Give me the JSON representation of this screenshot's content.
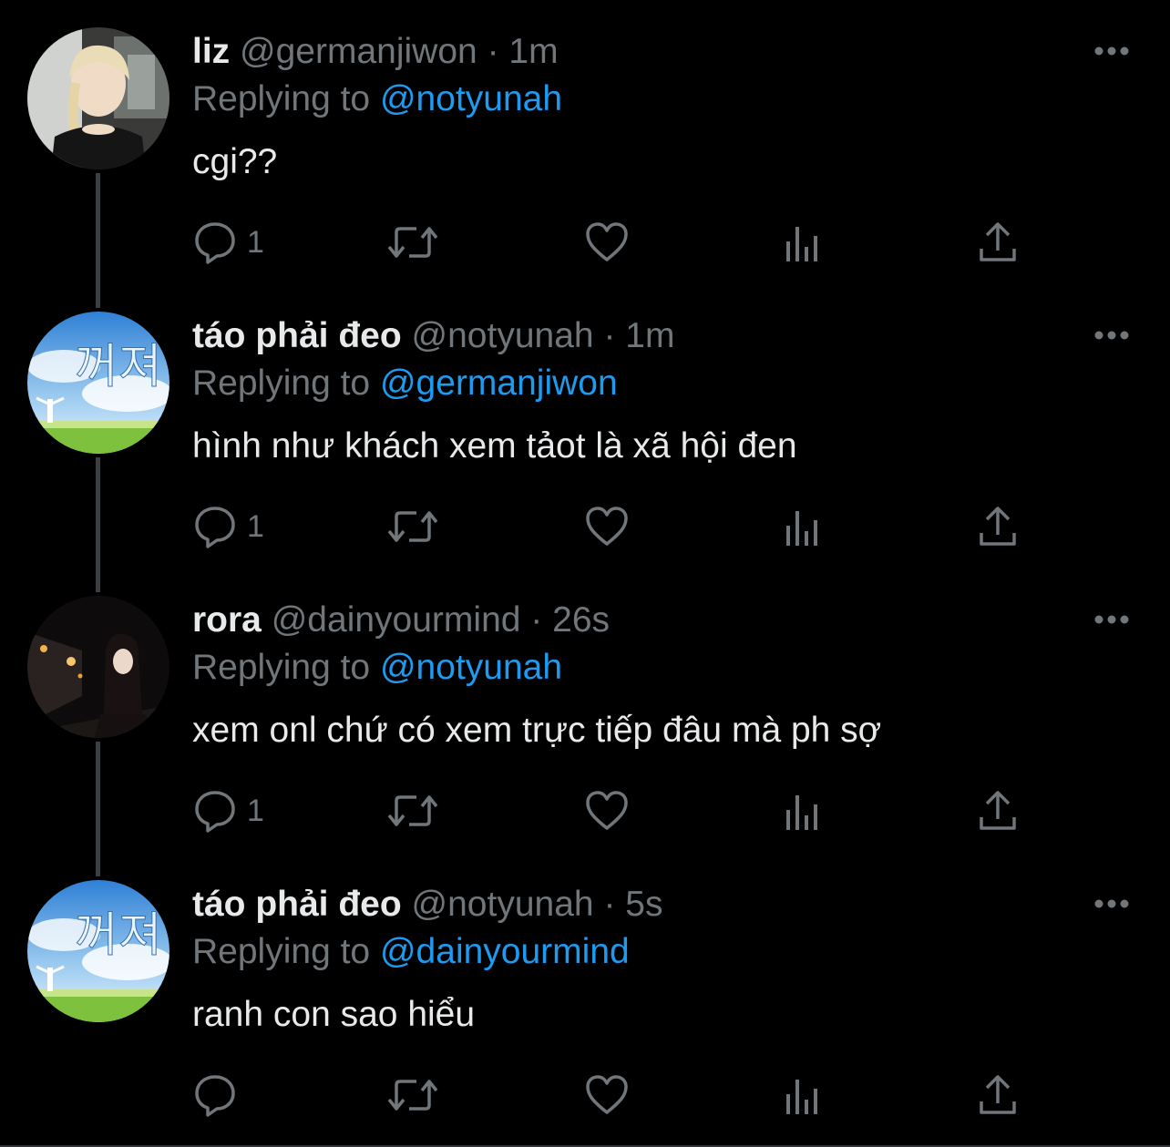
{
  "colors": {
    "background": "#000000",
    "text_primary": "#e7e9ea",
    "text_secondary": "#71767b",
    "accent_link": "#1d9bf0",
    "thread_line": "#3b3f44"
  },
  "tweets": [
    {
      "name": "liz",
      "handle": "@germanjiwon",
      "separator": "·",
      "time": "1m",
      "replying_prefix": "Replying to",
      "replying_to": "@notyunah",
      "text": "cgi??",
      "reply_count": "1",
      "avatar": "woman-blonde-braid-avatar"
    },
    {
      "name": "táo phải đeo",
      "handle": "@notyunah",
      "separator": "·",
      "time": "1m",
      "replying_prefix": "Replying to",
      "replying_to": "@germanjiwon",
      "text": "hình như khách xem tảot là xã hội đen",
      "reply_count": "1",
      "avatar": "sky-field-korean-text-avatar"
    },
    {
      "name": "rora",
      "handle": "@dainyourmind",
      "separator": "·",
      "time": "26s",
      "replying_prefix": "Replying to",
      "replying_to": "@notyunah",
      "text": "xem onl chứ có xem trực tiếp đâu mà ph sợ",
      "reply_count": "1",
      "avatar": "night-tunnel-woman-avatar"
    },
    {
      "name": "táo phải đeo",
      "handle": "@notyunah",
      "separator": "·",
      "time": "5s",
      "replying_prefix": "Replying to",
      "replying_to": "@dainyourmind",
      "text": "ranh con sao hiểu",
      "reply_count": "",
      "avatar": "sky-field-korean-text-avatar"
    }
  ],
  "icons": {
    "reply": "reply-bubble-icon",
    "retweet": "retweet-icon",
    "like": "heart-icon",
    "views": "views-bar-chart-icon",
    "share": "share-upload-icon",
    "more": "more-options-icon"
  }
}
